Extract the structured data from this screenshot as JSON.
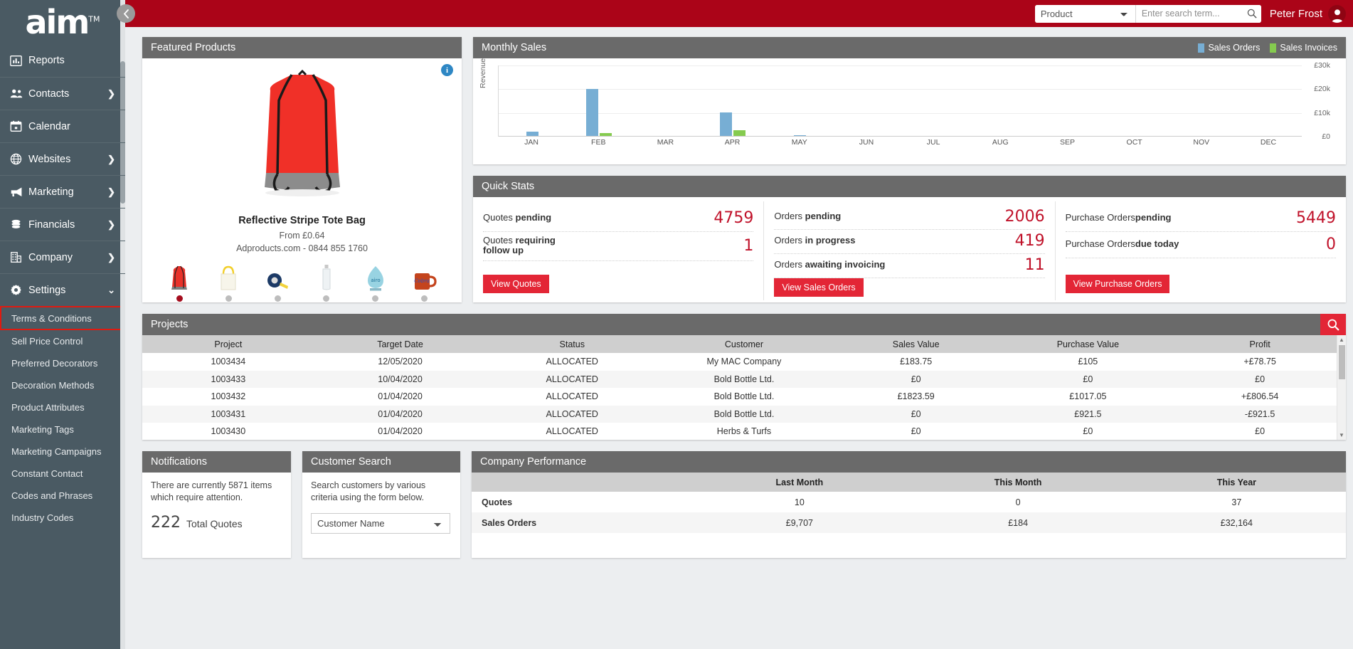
{
  "sidebar": {
    "logo": "aim",
    "logo_tm": "TM",
    "collapse_icon": "chevron-left-icon",
    "items": [
      {
        "label": "Reports",
        "icon": "bar-chart-icon",
        "chevron": ""
      },
      {
        "label": "Contacts",
        "icon": "people-icon",
        "chevron": "❯"
      },
      {
        "label": "Calendar",
        "icon": "calendar-icon",
        "chevron": ""
      },
      {
        "label": "Websites",
        "icon": "globe-icon",
        "chevron": "❯"
      },
      {
        "label": "Marketing",
        "icon": "megaphone-icon",
        "chevron": "❯"
      },
      {
        "label": "Financials",
        "icon": "coins-icon",
        "chevron": "❯"
      },
      {
        "label": "Company",
        "icon": "building-icon",
        "chevron": "❯"
      },
      {
        "label": "Settings",
        "icon": "gear-icon",
        "chevron": "⌄"
      }
    ],
    "sub_items": [
      {
        "label": "Terms & Conditions",
        "selected": true
      },
      {
        "label": "Sell Price Control",
        "selected": false
      },
      {
        "label": "Preferred Decorators",
        "selected": false
      },
      {
        "label": "Decoration Methods",
        "selected": false
      },
      {
        "label": "Product Attributes",
        "selected": false
      },
      {
        "label": "Marketing Tags",
        "selected": false
      },
      {
        "label": "Marketing Campaigns",
        "selected": false
      },
      {
        "label": "Constant Contact",
        "selected": false
      },
      {
        "label": "Codes and Phrases",
        "selected": false
      },
      {
        "label": "Industry Codes",
        "selected": false
      }
    ]
  },
  "topbar": {
    "search_scope": "Product",
    "search_placeholder": "Enter search term...",
    "search_value": "",
    "search_icon": "magnifier-icon",
    "user_name": "Peter Frost",
    "avatar_icon": "user-avatar-icon",
    "brand_color": "#ab0418"
  },
  "featured": {
    "title": "Featured Products",
    "info_icon": "info-icon",
    "product_name": "Reflective Stripe Tote Bag",
    "price": "From £0.64",
    "vendor": "Adproducts.com - 0844 855 1760",
    "thumbnails": [
      {
        "name": "red-drawstring-bag",
        "active": true
      },
      {
        "name": "yellow-tote-bag",
        "active": false
      },
      {
        "name": "tape-measure",
        "active": false
      },
      {
        "name": "water-bottle",
        "active": false
      },
      {
        "name": "glass-award",
        "active": false
      },
      {
        "name": "orange-mug",
        "active": false
      }
    ]
  },
  "monthly": {
    "title": "Monthly Sales",
    "legend": [
      {
        "label": "Sales Orders",
        "color": "#77aed4"
      },
      {
        "label": "Sales Invoices",
        "color": "#85cb4f"
      }
    ]
  },
  "chart_data": {
    "type": "bar",
    "title": "Monthly Sales",
    "xlabel": "",
    "ylabel": "Revenue",
    "categories": [
      "JAN",
      "FEB",
      "MAR",
      "APR",
      "MAY",
      "JUN",
      "JUL",
      "AUG",
      "SEP",
      "OCT",
      "NOV",
      "DEC"
    ],
    "series": [
      {
        "name": "Sales Orders",
        "color": "#77aed4",
        "values": [
          1800,
          20000,
          0,
          9900,
          350,
          0,
          0,
          0,
          0,
          0,
          0,
          0
        ]
      },
      {
        "name": "Sales Invoices",
        "color": "#85cb4f",
        "values": [
          0,
          1300,
          0,
          2300,
          0,
          0,
          0,
          0,
          0,
          0,
          0,
          0
        ]
      }
    ],
    "ylim": [
      0,
      30000
    ],
    "yticks": [
      0,
      10000,
      20000,
      30000
    ],
    "ytick_labels": [
      "£0",
      "£10k",
      "£20k",
      "£30k"
    ],
    "grid": true,
    "legend_position": "top-right"
  },
  "quick_stats": {
    "title": "Quick Stats",
    "columns": [
      {
        "rows": [
          {
            "prefix": "Quotes ",
            "bold": "pending",
            "suffix": "",
            "value": "4759"
          },
          {
            "prefix": "Quotes ",
            "bold": "requiring",
            "suffix": "follow up",
            "value": "1"
          }
        ],
        "button": "View Quotes"
      },
      {
        "rows": [
          {
            "prefix": "Orders ",
            "bold": "pending",
            "suffix": "",
            "value": "2006"
          },
          {
            "prefix": "Orders ",
            "bold": "in progress",
            "suffix": "",
            "value": "419"
          },
          {
            "prefix": "Orders ",
            "bold": "awaiting invoicing",
            "suffix": "",
            "value": "11"
          }
        ],
        "button": "View Sales Orders"
      },
      {
        "rows": [
          {
            "prefix": "Purchase Orders",
            "bold": "pending",
            "suffix": "",
            "value": "5449"
          },
          {
            "prefix": "Purchase Orders",
            "bold": "due today",
            "suffix": "",
            "value": "0"
          }
        ],
        "button": "View Purchase Orders"
      }
    ]
  },
  "projects": {
    "title": "Projects",
    "search_icon": "magnifier-icon",
    "headers": [
      "Project",
      "Target Date",
      "Status",
      "Customer",
      "Sales Value",
      "Purchase Value",
      "Profit"
    ],
    "rows": [
      {
        "project": "1003434",
        "date": "12/05/2020",
        "status": "ALLOCATED",
        "customer": "My MAC Company",
        "sales": "£183.75",
        "purchase": "£105",
        "profit": "+£78.75",
        "profit_sign": "pos"
      },
      {
        "project": "1003433",
        "date": "10/04/2020",
        "status": "ALLOCATED",
        "customer": "Bold Bottle Ltd.",
        "sales": "£0",
        "purchase": "£0",
        "profit": "£0",
        "profit_sign": "zero"
      },
      {
        "project": "1003432",
        "date": "01/04/2020",
        "status": "ALLOCATED",
        "customer": "Bold Bottle Ltd.",
        "sales": "£1823.59",
        "purchase": "£1017.05",
        "profit": "+£806.54",
        "profit_sign": "pos"
      },
      {
        "project": "1003431",
        "date": "01/04/2020",
        "status": "ALLOCATED",
        "customer": "Bold Bottle Ltd.",
        "sales": "£0",
        "purchase": "£921.5",
        "profit": "-£921.5",
        "profit_sign": "neg"
      },
      {
        "project": "1003430",
        "date": "01/04/2020",
        "status": "ALLOCATED",
        "customer": "Herbs & Turfs",
        "sales": "£0",
        "purchase": "£0",
        "profit": "£0",
        "profit_sign": "zero"
      }
    ]
  },
  "notifications": {
    "title": "Notifications",
    "text": "There are currently 5871 items which require attention.",
    "stat_number": "222",
    "stat_label": "Total Quotes"
  },
  "customer_search": {
    "title": "Customer Search",
    "text": "Search customers by various criteria using the form below.",
    "select_value": "Customer Name"
  },
  "performance": {
    "title": "Company Performance",
    "headers": [
      "",
      "Last Month",
      "This Month",
      "This Year"
    ],
    "rows": [
      {
        "label": "Quotes",
        "last_month": "10",
        "this_month": "0",
        "this_year": "37"
      },
      {
        "label": "Sales Orders",
        "last_month": "£9,707",
        "this_month": "£184",
        "this_year": "£32,164"
      }
    ]
  }
}
